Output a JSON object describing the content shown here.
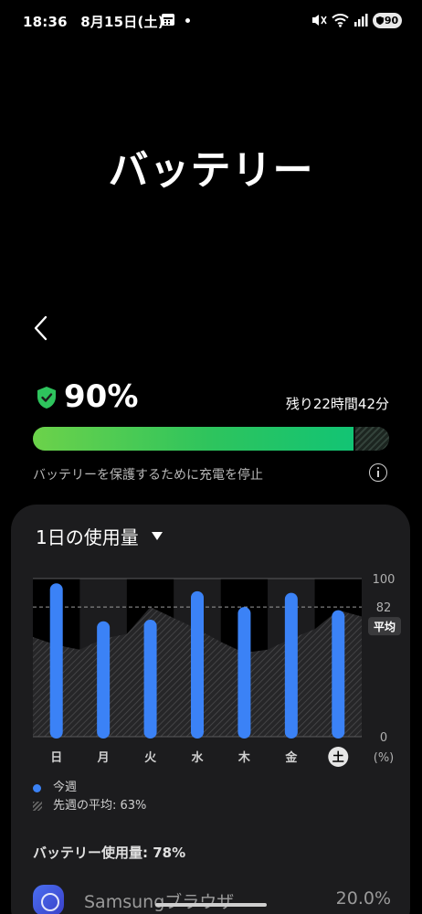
{
  "status_bar": {
    "time": "18:36",
    "date": "8月15日(土)",
    "battery": "90"
  },
  "title": "バッテリー",
  "battery": {
    "percent_text": "90%",
    "level": 0.9,
    "remaining": "残り22時間42分",
    "protect_message": "バッテリーを保護するために充電を停止"
  },
  "usage": {
    "period": "1日の使用量",
    "legend_this_week": "今週",
    "legend_last_week": "先週の平均: 63%",
    "usage_title": "バッテリー使用量: 78%",
    "app_name": "Samsungブラウザ",
    "app_percent": "20.0%"
  },
  "colors": {
    "accent_blue": "#3b82f6",
    "battery_green": "#2ec45d"
  },
  "chart_data": {
    "type": "bar",
    "categories": [
      "日",
      "月",
      "火",
      "水",
      "木",
      "金",
      "土"
    ],
    "series": [
      {
        "name": "今週",
        "values": [
          97,
          73,
          74,
          92,
          82,
          91,
          80
        ]
      }
    ],
    "last_week_curve": [
      63,
      58,
      55,
      62,
      65,
      82,
      75,
      68,
      60,
      53,
      55,
      62,
      68,
      80,
      76
    ],
    "average_value": 82,
    "average_label": "平均",
    "ylim": [
      0,
      100
    ],
    "yticks": [
      100,
      82,
      0
    ],
    "yunit": "(%)",
    "highlighted_category": "土",
    "grid": true
  }
}
